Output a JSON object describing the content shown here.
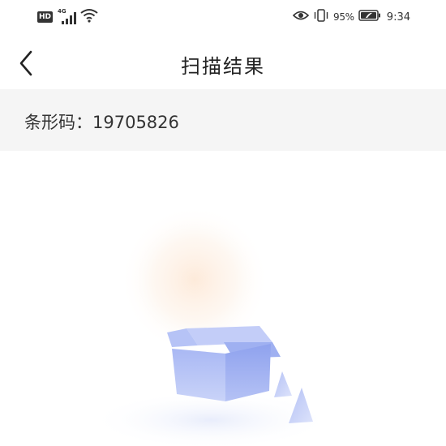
{
  "status_bar": {
    "hd_badge": "HD",
    "network_type": "4G",
    "battery_percent": "95%",
    "time": "9:34",
    "icons": [
      "hd-icon",
      "signal-icon",
      "wifi-icon",
      "eye-icon",
      "vibrate-icon",
      "battery-icon"
    ]
  },
  "header": {
    "title": "扫描结果",
    "back_icon": "chevron-left-icon"
  },
  "result": {
    "label": "条形码：19705826"
  },
  "empty_state": {
    "icon": "empty-box-icon"
  },
  "colors": {
    "background": "#ffffff",
    "result_row_bg": "#f5f5f5",
    "text_primary": "#222222",
    "box_fill": "#a9b8f4"
  }
}
